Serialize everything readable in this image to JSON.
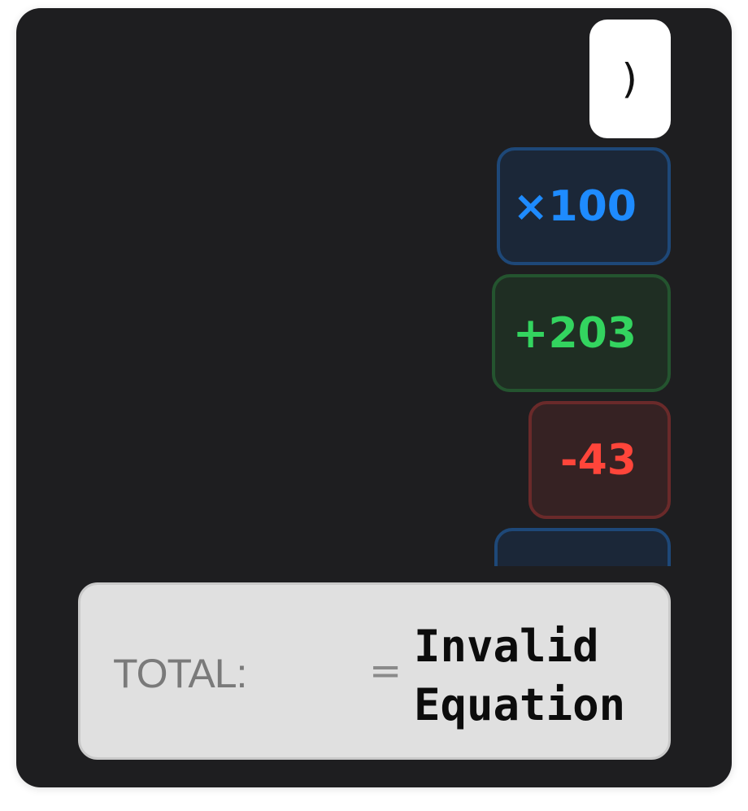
{
  "tiles": [
    {
      "id": "paren",
      "label": ")",
      "kind": "parenthesis"
    },
    {
      "id": "mult",
      "label": "×100",
      "kind": "multiply",
      "color": "#1e8bff"
    },
    {
      "id": "plus",
      "label": "+203",
      "kind": "add",
      "color": "#33d45f"
    },
    {
      "id": "minus",
      "label": "-43",
      "kind": "subtract",
      "color": "#ff453a"
    },
    {
      "id": "partial",
      "label": "",
      "kind": "multiply",
      "color": "#1e8bff"
    }
  ],
  "total": {
    "label": "TOTAL:",
    "equals": "=",
    "result": "Invalid\nEquation"
  },
  "colors": {
    "card_background": "#1e1e20",
    "total_background": "#e0e0e0"
  }
}
